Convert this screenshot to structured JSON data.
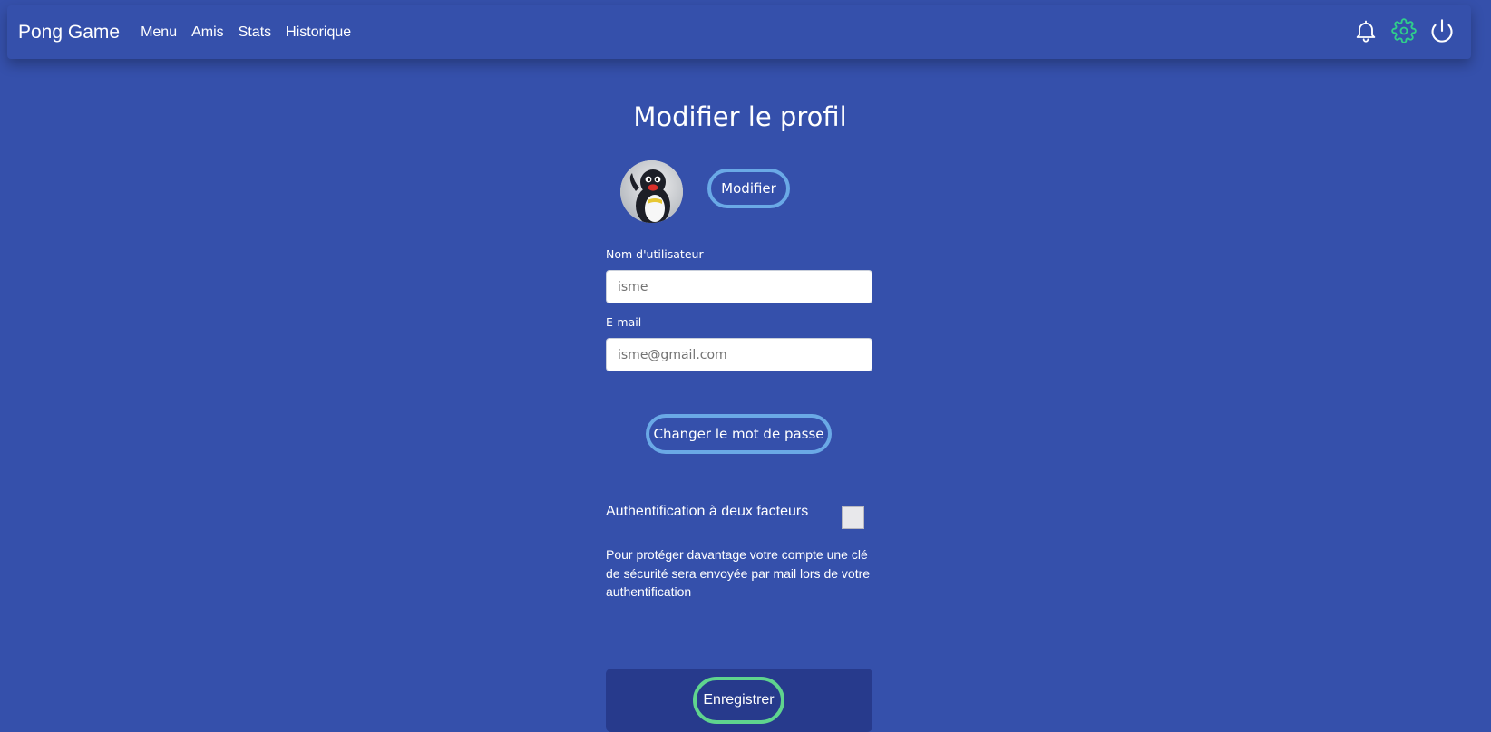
{
  "navbar": {
    "brand": "Pong Game",
    "links": [
      "Menu",
      "Amis",
      "Stats",
      "Historique"
    ],
    "icons": [
      "bell-icon",
      "gear-icon",
      "power-icon"
    ],
    "active_icon_color": "#2fd08a"
  },
  "profile": {
    "title": "Modifier le profil",
    "modify_label": "Modifier",
    "username_label": "Nom d'utilisateur",
    "username_placeholder": "isme",
    "email_label": "E-mail",
    "email_placeholder": "isme@gmail.com",
    "password_label": "Changer le mot de passe",
    "twofa_label": "Authentification à deux facteurs",
    "twofa_description": "Pour protéger davantage votre compte une clé de sécurité sera envoyée par mail lors de votre authentification",
    "save_label": "Enregistrer"
  },
  "colors": {
    "background": "#3550ab",
    "pill_border": "#6aa9e6",
    "save_border": "#5fd48e",
    "save_panel": "#273a8c"
  }
}
